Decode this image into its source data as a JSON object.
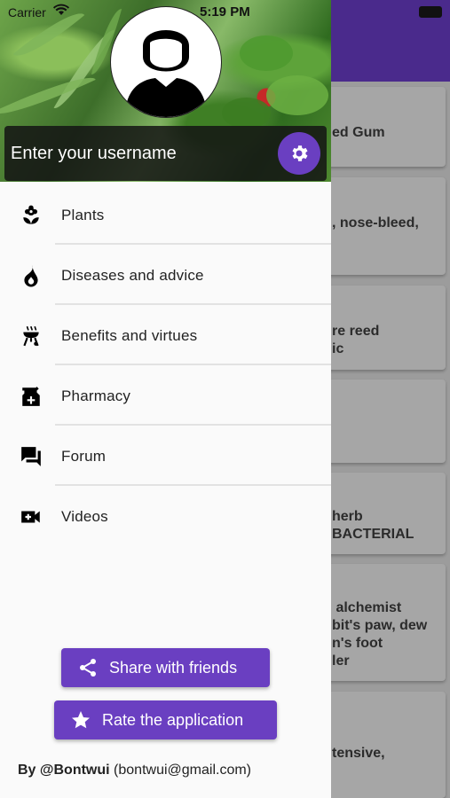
{
  "status_bar": {
    "carrier": "Carrier",
    "time": "5:19 PM"
  },
  "drawer": {
    "username_placeholder": "Enter your username",
    "menu": [
      {
        "label": "Plants",
        "icon": "flower-icon"
      },
      {
        "label": "Diseases and advice",
        "icon": "fire-icon"
      },
      {
        "label": "Benefits and virtues",
        "icon": "grill-icon"
      },
      {
        "label": "Pharmacy",
        "icon": "pharmacy-icon"
      },
      {
        "label": "Forum",
        "icon": "forum-icon"
      },
      {
        "label": "Videos",
        "icon": "video-call-icon"
      }
    ],
    "share_label": "Share with friends",
    "rate_label": "Rate the application",
    "footer_author": "By @Bontwui",
    "footer_email": "(bontwui@gmail.com)"
  },
  "background_list": {
    "items": [
      "ed Gum",
      ", nose-bleed,",
      "re reed\nic",
      "",
      "herb\nBACTERIAL",
      " alchemist\nbit's paw, dew\nn's foot\nler",
      "tensive,"
    ]
  },
  "colors": {
    "accent": "#6a3fc1",
    "appbar": "#4a2a8c"
  }
}
